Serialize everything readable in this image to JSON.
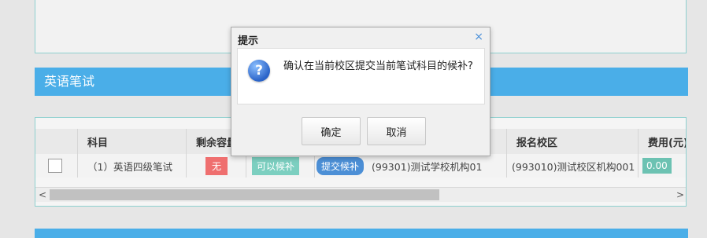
{
  "section": {
    "title": "英语笔试"
  },
  "table": {
    "headers": [
      "",
      "科目",
      "剩余容量",
      "",
      "",
      "报名校区",
      "费用(元)"
    ],
    "row": {
      "subject": "（1）英语四级笔试",
      "remaining": "无",
      "waitlist_status": "可以候补",
      "submit_waitlist": "提交候补",
      "school": "(99301)测试学校机构01",
      "campus": "(993010)测试校区机构001",
      "fee": "0.00"
    },
    "scroll_left": "<",
    "scroll_right": ">"
  },
  "dialog": {
    "title": "提示",
    "close": "×",
    "icon": "question-icon",
    "message": "确认在当前校区提交当前笔试科目的候补?",
    "ok_label": "确定",
    "cancel_label": "取消"
  },
  "colors": {
    "section_bar": "#4aaee8",
    "badge_red": "#ef6f6f",
    "badge_teal": "#7ccfc0",
    "badge_blue": "#4c8fd6"
  }
}
